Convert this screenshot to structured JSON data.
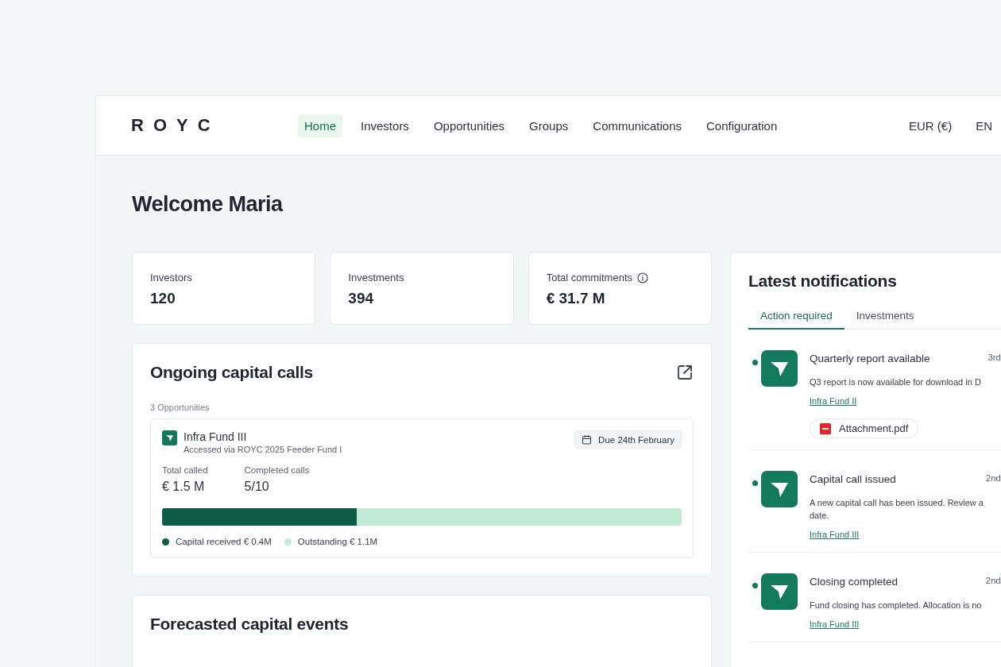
{
  "header": {
    "logo": "ROYC",
    "nav": [
      {
        "label": "Home",
        "selected": true
      },
      {
        "label": "Investors",
        "selected": false
      },
      {
        "label": "Opportunities",
        "selected": false
      },
      {
        "label": "Groups",
        "selected": false
      },
      {
        "label": "Communications",
        "selected": false
      },
      {
        "label": "Configuration",
        "selected": false
      }
    ],
    "currency": "EUR (€)",
    "language": "EN"
  },
  "greeting": "Welcome Maria",
  "stats": [
    {
      "label": "Investors",
      "value": "120",
      "info": false
    },
    {
      "label": "Investments",
      "value": "394",
      "info": false
    },
    {
      "label": "Total commitments",
      "value": "€ 31.7 M",
      "info": true
    }
  ],
  "capital_calls": {
    "title": "Ongoing capital calls",
    "count": "3 Opportunities",
    "items": [
      {
        "name": "Infra Fund III",
        "via": "Accessed via ROYC 2025 Feeder Fund I",
        "due": "Due 24th February",
        "metrics": [
          {
            "label": "Total called",
            "value": "€ 1.5 M"
          },
          {
            "label": "Completed calls",
            "value": "5/10"
          }
        ],
        "level": 0.375,
        "legend": [
          {
            "label": "Capital received € 0.4M",
            "color": "#0e5c48"
          },
          {
            "label": "Outstanding € 1.1M",
            "color": "#c2ebd5"
          }
        ]
      }
    ]
  },
  "forecast": {
    "title": "Forecasted capital events"
  },
  "notifications": {
    "title": "Latest notifications",
    "tabs": [
      {
        "label": "Action required",
        "selected": true
      },
      {
        "label": "Investments",
        "selected": false
      }
    ],
    "items": [
      {
        "title": "Quarterly report available",
        "date": "3rd",
        "unread": true,
        "lines": [
          "Q3 report is now available for download in D"
        ],
        "link": "Infra Fund II",
        "attachment": "Attachment.pdf"
      },
      {
        "title": "Capital call issued",
        "date": "2nd",
        "unread": true,
        "lines": [
          "A new capital call has been issued. Review a",
          "date."
        ],
        "link": "Infra Fund III"
      },
      {
        "title": "Closing completed",
        "date": "2nd",
        "unread": true,
        "lines": [
          "Fund closing has completed. Allocation is no"
        ],
        "link": "Infra Fund III"
      }
    ]
  }
}
